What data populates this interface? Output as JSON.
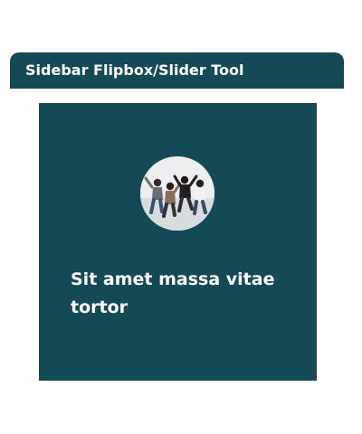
{
  "widget": {
    "title": "Sidebar Flipbox/Slider Tool"
  },
  "card": {
    "text": "Sit amet massa vitae tortor",
    "image_icon": "group-jumping-photo",
    "background_color": "#134a56"
  }
}
